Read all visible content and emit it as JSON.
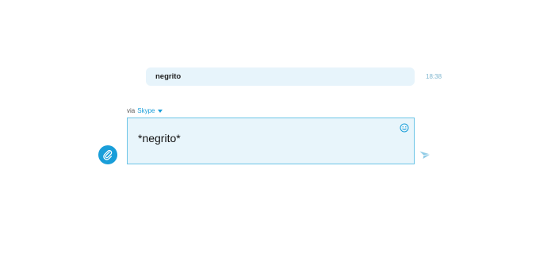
{
  "conversation": {
    "messages": [
      {
        "text": "negrito",
        "time": "18:38"
      }
    ]
  },
  "composer": {
    "via_label": "via",
    "via_service": "Skype",
    "draft_text": "*negrito*"
  },
  "icons": {
    "attach": "paperclip-icon",
    "emoji": "smiley-icon",
    "send": "send-icon",
    "service_dropdown": "chevron-down-icon"
  },
  "colors": {
    "accent": "#199ed9",
    "bubble_bg": "#e7f4fb",
    "compose_bg": "#e8f5fb",
    "compose_border": "#6cc5e7",
    "timestamp": "#7fb6cf"
  }
}
